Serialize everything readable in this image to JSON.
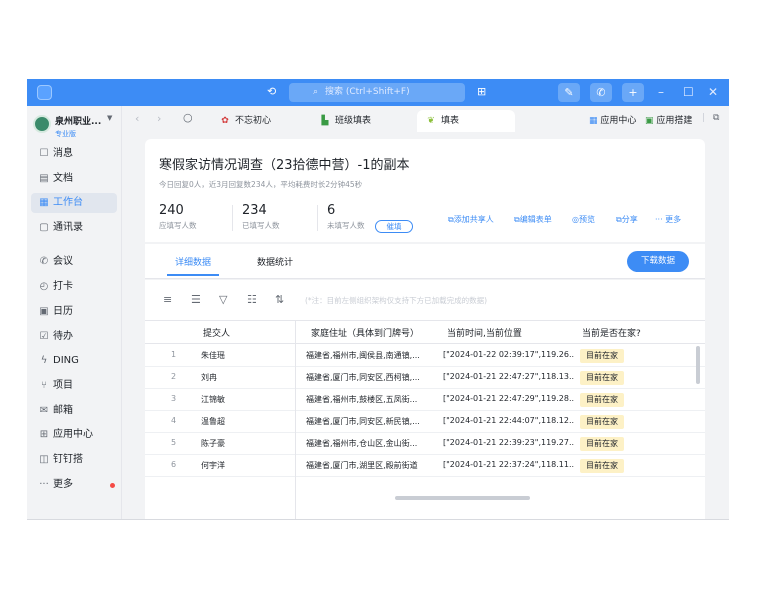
{
  "titlebar": {
    "search_placeholder": "搜索 (Ctrl+Shift+F)",
    "history_icon": "history-icon",
    "grid_icon": "grid-icon",
    "accent": "#3d8cf5"
  },
  "sidebar": {
    "org_name": "泉州职业...",
    "org_tag": "专业版",
    "items": [
      {
        "icon": "message-icon",
        "glyph": "☐",
        "label": "消息"
      },
      {
        "icon": "document-icon",
        "glyph": "▤",
        "label": "文档"
      },
      {
        "icon": "workbench-icon",
        "glyph": "▦",
        "label": "工作台"
      },
      {
        "icon": "contacts-icon",
        "glyph": "▢",
        "label": "通讯录"
      },
      {
        "icon": "meeting-icon",
        "glyph": "✆",
        "label": "会议"
      },
      {
        "icon": "punch-icon",
        "glyph": "◴",
        "label": "打卡"
      },
      {
        "icon": "calendar-icon",
        "glyph": "▣",
        "label": "日历"
      },
      {
        "icon": "todo-icon",
        "glyph": "☑",
        "label": "待办"
      },
      {
        "icon": "ding-icon",
        "glyph": "ϟ",
        "label": "DING"
      },
      {
        "icon": "project-icon",
        "glyph": "⑂",
        "label": "项目"
      },
      {
        "icon": "mail-icon",
        "glyph": "✉",
        "label": "邮箱"
      },
      {
        "icon": "app-center-icon",
        "glyph": "⊞",
        "label": "应用中心"
      },
      {
        "icon": "dingding-icon",
        "glyph": "◫",
        "label": "钉钉搭"
      },
      {
        "icon": "more-icon",
        "glyph": "···",
        "label": "更多"
      }
    ]
  },
  "tabs": [
    {
      "label": "不忘初心",
      "icon": "party-icon",
      "glyph": "✿",
      "color": "#d33c3c"
    },
    {
      "label": "班级填表",
      "icon": "form-icon",
      "glyph": "▙",
      "color": "#3a9a44"
    },
    {
      "label": "填表",
      "icon": "leaf-icon",
      "glyph": "❦",
      "color": "#8bbf3a"
    }
  ],
  "tabbar_right": {
    "app_center": "应用中心",
    "app_builder": "应用搭建"
  },
  "form": {
    "title": "寒假家访情况调查（23拾德中营）-1的副本",
    "subtitle": "今日回复0人，近3月回复数234人，平均耗费时长2分钟45秒",
    "stats": [
      {
        "value": "240",
        "label": "应填写人数"
      },
      {
        "value": "234",
        "label": "已填写人数"
      },
      {
        "value": "6",
        "label": "未填写人数"
      }
    ],
    "remind_label": "催填",
    "actions": [
      {
        "icon": "add-collab-icon",
        "label": "添加共享人"
      },
      {
        "icon": "edit-icon",
        "label": "编辑表单"
      },
      {
        "icon": "preview-icon",
        "label": "预览"
      },
      {
        "icon": "share-icon",
        "label": "分享"
      },
      {
        "icon": "more-dots-icon",
        "label": "更多"
      }
    ]
  },
  "subtabs": {
    "detail": "详细数据",
    "stats": "数据统计",
    "download": "下载数据"
  },
  "toolbar": {
    "hint": "(*注：目前左侧组织架构仅支持下方已加载完成的数据)"
  },
  "table": {
    "headers": [
      "提交人",
      "家庭住址（具体到门牌号）",
      "当前时间,当前位置",
      "当前是否在家?"
    ],
    "rows": [
      {
        "index": "1",
        "name": "朱佳瑶",
        "address": "福建省,福州市,闽侯县,南通镇,...",
        "location": "[\"2024-01-22 02:39:17\",119.26...",
        "status": "目前在家"
      },
      {
        "index": "2",
        "name": "刘冉",
        "address": "福建省,厦门市,同安区,西柯镇,...",
        "location": "[\"2024-01-21 22:47:27\",118.13...",
        "status": "目前在家"
      },
      {
        "index": "3",
        "name": "江锦敏",
        "address": "福建省,福州市,鼓楼区,五凤街...",
        "location": "[\"2024-01-21 22:47:29\",119.28...",
        "status": "目前在家"
      },
      {
        "index": "4",
        "name": "温鲁超",
        "address": "福建省,厦门市,同安区,新民镇,...",
        "location": "[\"2024-01-21 22:44:07\",118.12...",
        "status": "目前在家"
      },
      {
        "index": "5",
        "name": "陈子豪",
        "address": "福建省,福州市,仓山区,金山街...",
        "location": "[\"2024-01-21 22:39:23\",119.27...",
        "status": "目前在家"
      },
      {
        "index": "6",
        "name": "何宇洋",
        "address": "福建省,厦门市,湖里区,殿前街道",
        "location": "[\"2024-01-21 22:37:24\",118.11...",
        "status": "目前在家"
      }
    ]
  }
}
